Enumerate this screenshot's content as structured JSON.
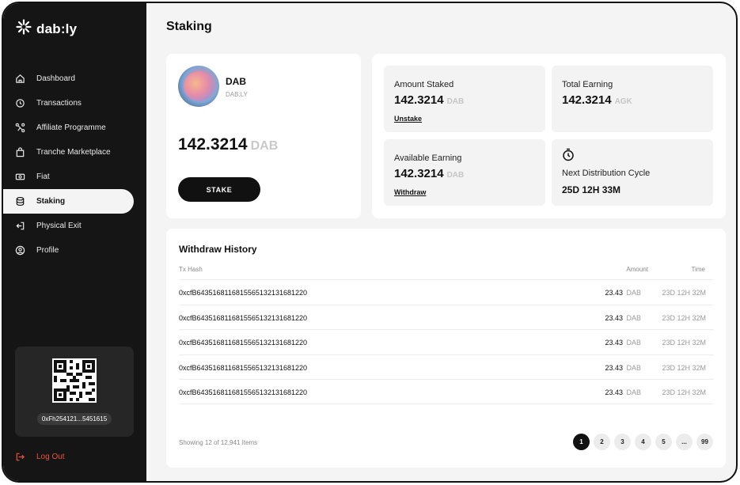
{
  "app": {
    "logo_text": "dab:ly"
  },
  "sidebar": {
    "items": [
      {
        "label": "Dashboard",
        "icon": "home-icon",
        "active": false
      },
      {
        "label": "Transactions",
        "icon": "clock-arrows-icon",
        "active": false
      },
      {
        "label": "Affiliate Programme",
        "icon": "network-icon",
        "active": false
      },
      {
        "label": "Tranche Marketplace",
        "icon": "shopping-bag-icon",
        "active": false
      },
      {
        "label": "Fiat",
        "icon": "cash-icon",
        "active": false
      },
      {
        "label": "Staking",
        "icon": "database-stack-icon",
        "active": true
      },
      {
        "label": "Physical Exit",
        "icon": "exit-icon",
        "active": false
      },
      {
        "label": "Profile",
        "icon": "user-circle-icon",
        "active": false
      }
    ],
    "wallet_address": "0xFh254121...5451615",
    "logout_label": "Log Out"
  },
  "page": {
    "title": "Staking"
  },
  "token": {
    "name": "DAB",
    "symbol": "DAB:LY",
    "balance": "142.3214",
    "balance_unit": "DAB",
    "stake_label": "STAKE"
  },
  "stats": {
    "amount_staked": {
      "label": "Amount Staked",
      "value": "142.3214",
      "unit": "DAB",
      "link": "Unstake"
    },
    "total_earning": {
      "label": "Total Earning",
      "value": "142.3214",
      "unit": "AGK"
    },
    "available_earning": {
      "label": "Available Earning",
      "value": "142.3214",
      "unit": "DAB",
      "link": "Withdraw"
    },
    "next_distribution": {
      "label": "Next Distribution Cycle",
      "value": "25D 12H 33M",
      "icon": "timer-icon"
    }
  },
  "history": {
    "title": "Withdraw History",
    "columns": {
      "hash": "Tx Hash",
      "amount": "Amount",
      "time": "Time"
    },
    "rows": [
      {
        "hash": "0xcfB6435168116815565132131681220",
        "amount": "23.43",
        "unit": "DAB",
        "time": "23D 12H 32M"
      },
      {
        "hash": "0xcfB6435168116815565132131681220",
        "amount": "23.43",
        "unit": "DAB",
        "time": "23D 12H 32M"
      },
      {
        "hash": "0xcfB6435168116815565132131681220",
        "amount": "23.43",
        "unit": "DAB",
        "time": "23D 12H 32M"
      },
      {
        "hash": "0xcfB6435168116815565132131681220",
        "amount": "23.43",
        "unit": "DAB",
        "time": "23D 12H 32M"
      },
      {
        "hash": "0xcfB6435168116815565132131681220",
        "amount": "23.43",
        "unit": "DAB",
        "time": "23D 12H 32M"
      }
    ],
    "showing_text": "Showing 12 of 12,941 Items",
    "pages": [
      "1",
      "2",
      "3",
      "4",
      "5",
      "...",
      "99"
    ],
    "current_page": "1"
  }
}
